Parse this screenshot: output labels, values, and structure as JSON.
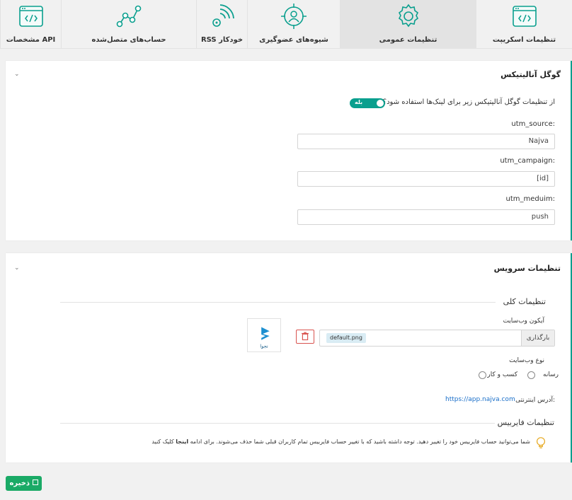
{
  "tabs": [
    {
      "label": "تنظیمات اسکریپت",
      "icon": "code-window-icon",
      "active": false
    },
    {
      "label": "تنظیمات عمومی",
      "icon": "gear-icon",
      "active": true
    },
    {
      "label": "شیوه‌های عضوگیری",
      "icon": "target-icon",
      "active": false
    },
    {
      "label": "RSS خودکار",
      "icon": "rss-icon",
      "active": false
    },
    {
      "label": "حساب‌های متصل‌شده",
      "icon": "connected-nodes-icon",
      "active": false
    },
    {
      "label": "مشخصات API",
      "icon": "code-window-icon",
      "active": false
    }
  ],
  "analytics": {
    "title": "گوگل آنالیتیکس",
    "question": "از تنظیمات گوگل آنالیتیکس زیر برای لینک‌ها استفاده شود؟",
    "toggle_label": "بله",
    "fields": [
      {
        "label": "utm_source:",
        "value": "Najva"
      },
      {
        "label": "utm_campaign:",
        "value": "[id]"
      },
      {
        "label": "utm_meduim:",
        "value": "push"
      }
    ]
  },
  "service": {
    "title": "تنظیمات سرویس",
    "general_title": "تنظیمات کلی",
    "icon_label": "آیکون وب‌سایت",
    "upload_label": "بارگذاری",
    "file_name": "default.png",
    "site_type_label": "نوع وب‌سایت",
    "radio_options": [
      "رسانه",
      "کسب و کار"
    ],
    "address_label": "آدرس اینترنتی:",
    "address_value": "https://app.najva.com",
    "logo_text": "نجوا",
    "firebase_title": "تنظیمات فایربیس",
    "firebase_note": "شما می‌توانید حساب فایربیس خود را تغییر دهید. توجه داشته باشید که با تغییر حساب فایربیس تمام کاربران قبلی شما حذف می‌شوند. برای ادامه",
    "firebase_link": "اینجا",
    "firebase_tail": "کلیک کنید"
  },
  "save_label": "ذخیره",
  "colors": {
    "accent": "#0a9f8e",
    "save": "#1aaa66",
    "danger": "#d9534f",
    "link": "#1a6fc9"
  }
}
